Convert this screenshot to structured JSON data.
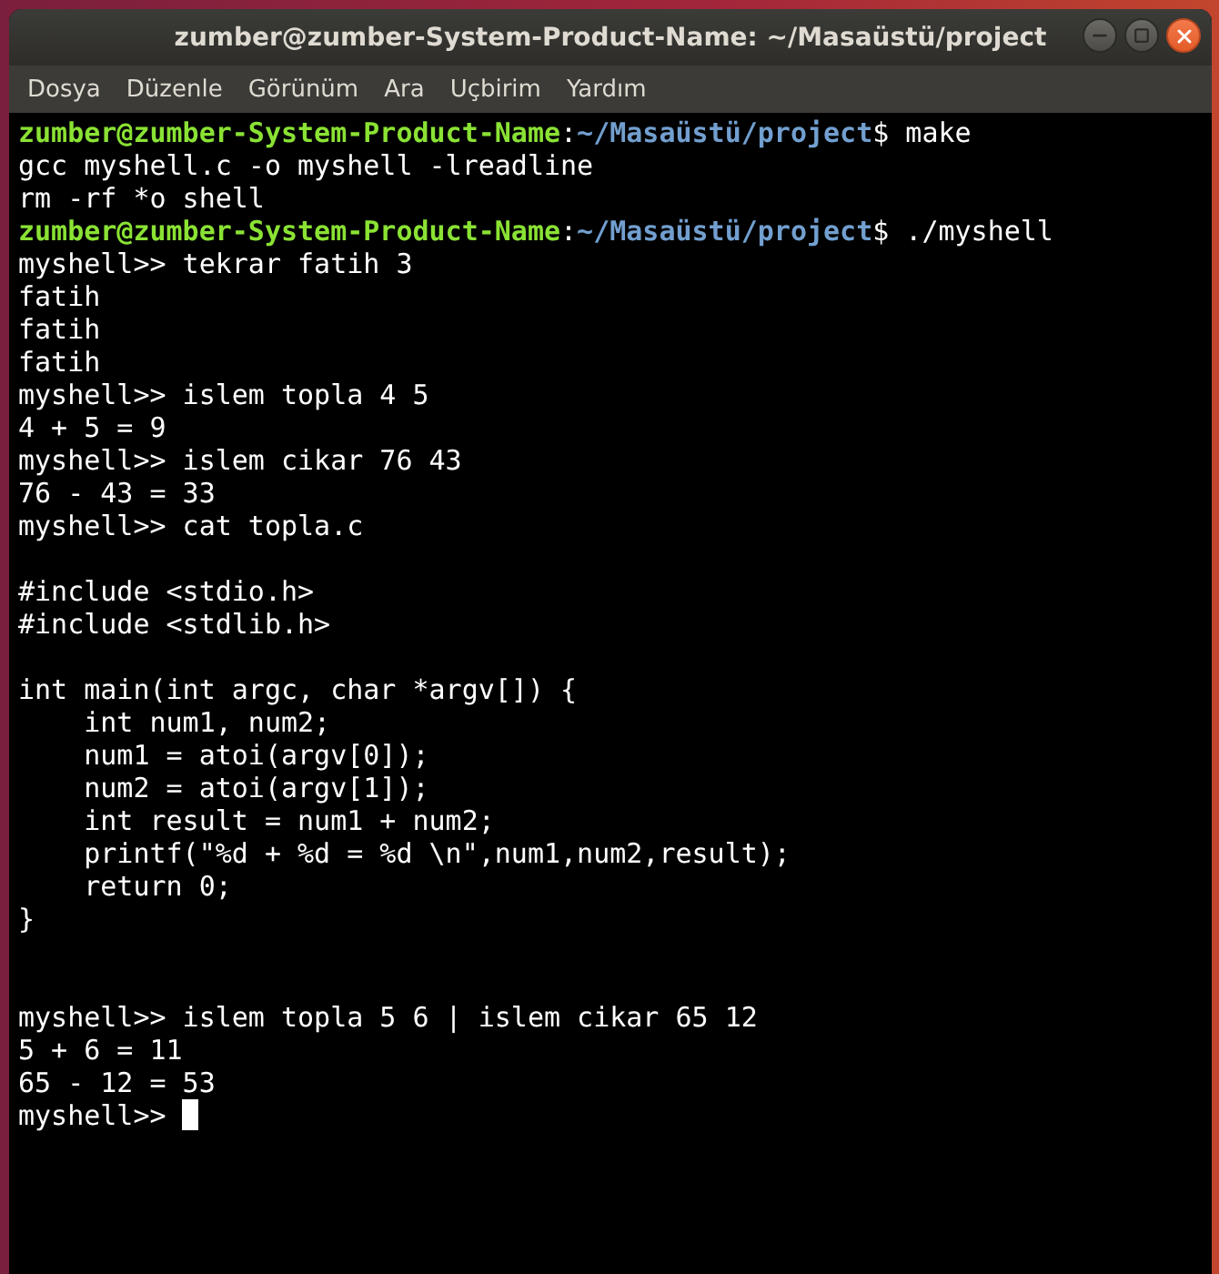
{
  "window": {
    "title": "zumber@zumber-System-Product-Name: ~/Masaüstü/project"
  },
  "menu": [
    "Dosya",
    "Düzenle",
    "Görünüm",
    "Ara",
    "Uçbirim",
    "Yardım"
  ],
  "terminal": {
    "lines": [
      {
        "kind": "prompt",
        "user": "zumber@zumber-System-Product-Name",
        "separator": ":",
        "path": "~/Masaüstü/project",
        "command": "$ make"
      },
      {
        "kind": "output",
        "text": "gcc myshell.c -o myshell -lreadline"
      },
      {
        "kind": "output",
        "text": "rm -rf *o shell"
      },
      {
        "kind": "prompt",
        "user": "zumber@zumber-System-Product-Name",
        "separator": ":",
        "path": "~/Masaüstü/project",
        "command": "$ ./myshell"
      },
      {
        "kind": "output",
        "text": "myshell>> tekrar fatih 3"
      },
      {
        "kind": "output",
        "text": "fatih"
      },
      {
        "kind": "output",
        "text": "fatih"
      },
      {
        "kind": "output",
        "text": "fatih"
      },
      {
        "kind": "output",
        "text": "myshell>> islem topla 4 5"
      },
      {
        "kind": "output",
        "text": "4 + 5 = 9"
      },
      {
        "kind": "output",
        "text": "myshell>> islem cikar 76 43"
      },
      {
        "kind": "output",
        "text": "76 - 43 = 33"
      },
      {
        "kind": "output",
        "text": "myshell>> cat topla.c"
      },
      {
        "kind": "blank"
      },
      {
        "kind": "output",
        "text": "#include <stdio.h>"
      },
      {
        "kind": "output",
        "text": "#include <stdlib.h>"
      },
      {
        "kind": "blank"
      },
      {
        "kind": "output",
        "text": "int main(int argc, char *argv[]) {"
      },
      {
        "kind": "output",
        "text": "    int num1, num2;"
      },
      {
        "kind": "output",
        "text": "    num1 = atoi(argv[0]);"
      },
      {
        "kind": "output",
        "text": "    num2 = atoi(argv[1]);"
      },
      {
        "kind": "output",
        "text": "    int result = num1 + num2;"
      },
      {
        "kind": "output",
        "text": "    printf(\"%d + %d = %d \\n\",num1,num2,result);"
      },
      {
        "kind": "output",
        "text": "    return 0;"
      },
      {
        "kind": "output",
        "text": "}"
      },
      {
        "kind": "blank"
      },
      {
        "kind": "blank"
      },
      {
        "kind": "output",
        "text": "myshell>> islem topla 5 6 | islem cikar 65 12"
      },
      {
        "kind": "output",
        "text": "5 + 6 = 11"
      },
      {
        "kind": "output",
        "text": "65 - 12 = 53"
      },
      {
        "kind": "input",
        "text": "myshell>> "
      }
    ]
  }
}
